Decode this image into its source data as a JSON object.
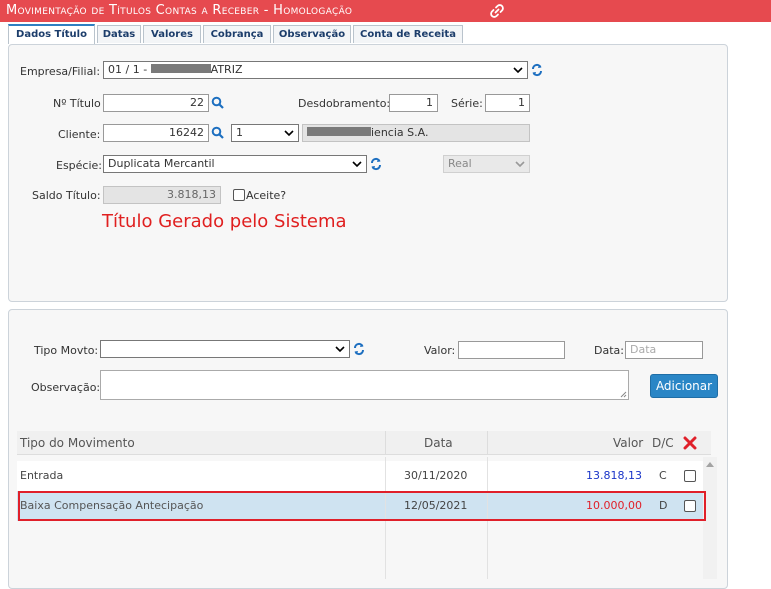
{
  "window": {
    "title": "Movimentação de Títulos Contas a Receber  - Homologação"
  },
  "tabs": [
    "Dados Título",
    "Datas",
    "Valores",
    "Cobrança",
    "Observação",
    "Conta de Receita"
  ],
  "dados": {
    "empresa_label": "Empresa/Filial:",
    "empresa_value_start": "01 / 1 - ",
    "empresa_value_end": "ATRIZ",
    "titulo_label": "Nº Título",
    "titulo_value": "22",
    "desdobramento_label": "Desdobramento:",
    "desdobramento_value": "1",
    "serie_label": "Série:",
    "serie_value": "1",
    "cliente_label": "Cliente:",
    "cliente_value": "16242",
    "cliente_sel": "1",
    "cliente_name_end": "iencia S.A.",
    "especie_label": "Espécie:",
    "especie_value": "Duplicata Mercantil",
    "moeda_value": "Real",
    "saldo_label": "Saldo Título:",
    "saldo_value": "3.818,13",
    "aceite_label": "Aceite?",
    "gerado_msg": "Título Gerado pelo Sistema"
  },
  "movto": {
    "tipo_label": "Tipo Movto:",
    "valor_label": "Valor:",
    "data_label": "Data:",
    "data_placeholder": "Data",
    "obs_label": "Observação:",
    "add_button": "Adicionar"
  },
  "grid": {
    "headers": {
      "tipo": "Tipo do Movimento",
      "data": "Data",
      "valor": "Valor",
      "dc": "D/C"
    },
    "rows": [
      {
        "tipo": "Entrada",
        "data": "30/11/2020",
        "valor": "13.818,13",
        "dc": "C"
      },
      {
        "tipo": "Baixa Compensação Antecipação",
        "data": "12/05/2021",
        "valor": "10.000,00",
        "dc": "D"
      }
    ]
  },
  "colors": {
    "title_bar": "#e64a4f",
    "accent": "#2a86c6",
    "highlight": "#e0202a",
    "credit_value": "#1a35c8",
    "debit_value": "#e0202a"
  }
}
